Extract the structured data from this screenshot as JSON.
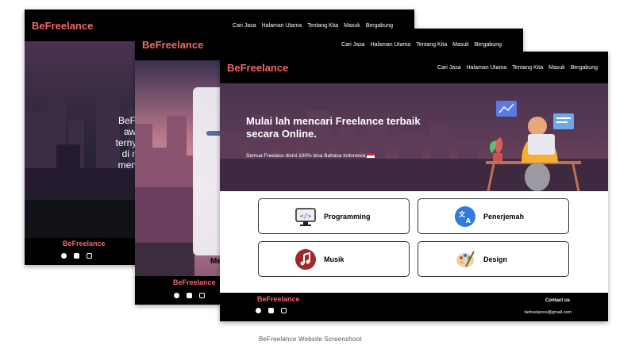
{
  "brand": {
    "name": "BeFreelance",
    "logo_color": "#f0686a"
  },
  "nav": {
    "items": [
      "Cari Jasa",
      "Halaman Utama",
      "Tentang Kita",
      "Masuk",
      "Bergabung"
    ]
  },
  "screen1": {
    "hero_lines": [
      "BeFreelance",
      "awalnya u",
      "ternyata webs",
      "di masa pa",
      "menjadi freel"
    ]
  },
  "screen2": {
    "panel_fragment": "Me"
  },
  "screen3": {
    "headline": "Mulai lah mencari Freelance terbaik secara Online.",
    "subtitle": "Semua Freelace disini 100% bisa Bahasa Indonesia",
    "categories": [
      {
        "label": "Programming",
        "icon": "monitor-code-icon"
      },
      {
        "label": "Penerjemah",
        "icon": "translate-icon"
      },
      {
        "label": "Musik",
        "icon": "music-note-icon"
      },
      {
        "label": "Design",
        "icon": "palette-icon"
      }
    ],
    "footer": {
      "contact_title": "Contact us",
      "email": "befreelance@gmail.com"
    }
  },
  "social_icons": [
    "facebook-icon",
    "discord-icon",
    "instagram-icon"
  ],
  "caption": "BeFreelance Website Screenshoot"
}
